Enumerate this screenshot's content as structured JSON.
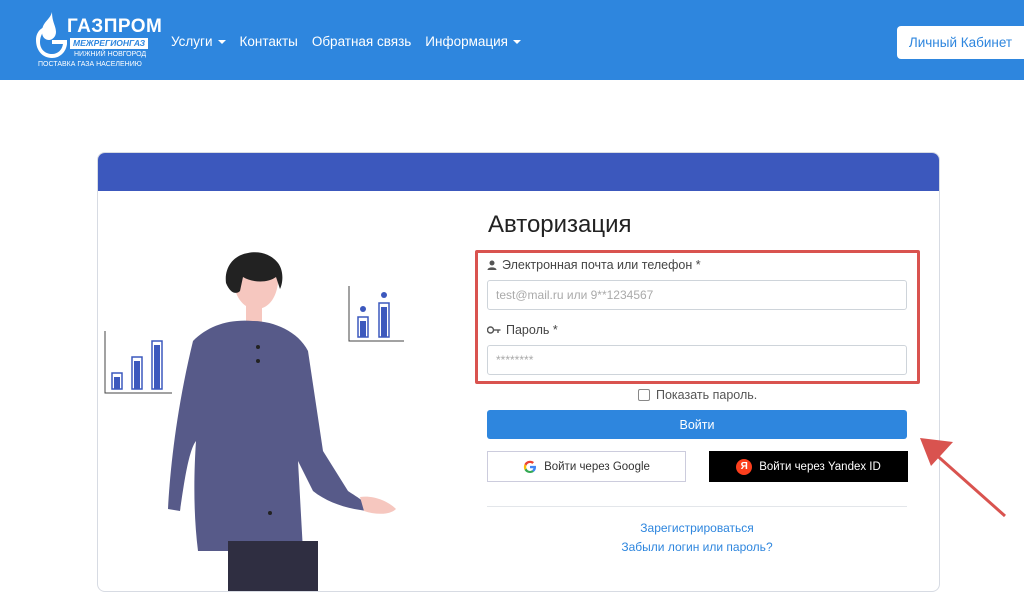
{
  "header": {
    "logo": {
      "title": "ГАЗПРОМ",
      "sub1": "МЕЖРЕГИОНГАЗ",
      "sub2": "НИЖНИЙ НОВГОРОД",
      "sub3": "ПОСТАВКА ГАЗА НАСЕЛЕНИЮ"
    },
    "nav": [
      {
        "label": "Услуги",
        "has_caret": true
      },
      {
        "label": "Контакты",
        "has_caret": false
      },
      {
        "label": "Обратная связь",
        "has_caret": false
      },
      {
        "label": "Информация",
        "has_caret": true
      }
    ],
    "cabinet_label": "Личный Кабинет"
  },
  "form": {
    "title": "Авторизация",
    "email_label": "Электронная почта или телефон *",
    "email_placeholder": "test@mail.ru или 9**1234567",
    "password_label": "Пароль *",
    "password_placeholder": "********",
    "show_password_label": "Показать пароль.",
    "login_label": "Войти",
    "google_label": "Войти через Google",
    "yandex_label": "Войти через Yandex ID",
    "yandex_logo_letter": "Я",
    "register_label": "Зарегистрироваться",
    "forgot_label": "Забыли логин или пароль?"
  },
  "colors": {
    "topbar": "#2e86de",
    "card_header": "#3c58bd",
    "highlight": "#d9534f",
    "accent": "#2e86de"
  }
}
